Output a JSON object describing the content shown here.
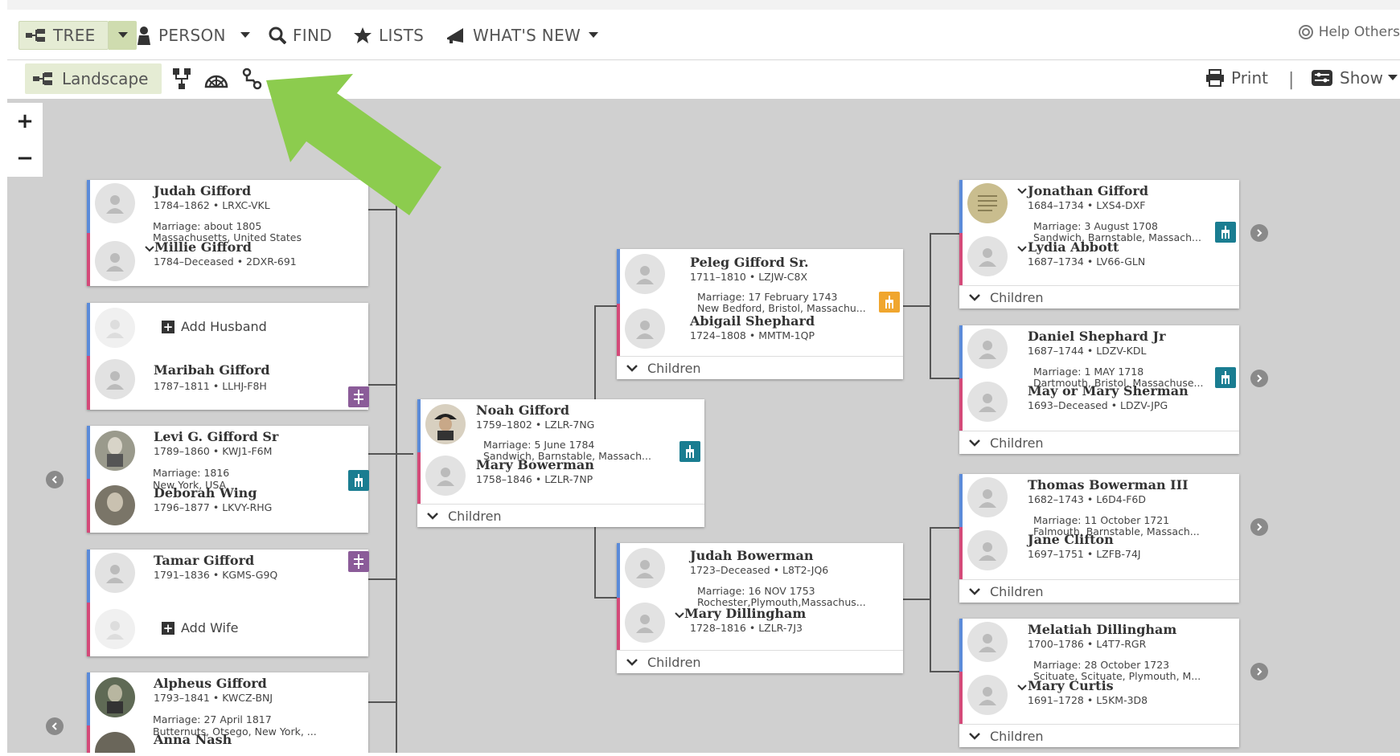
{
  "nav": {
    "tree": "TREE",
    "person": "PERSON",
    "find": "FIND",
    "lists": "LISTS",
    "whats_new": "WHAT'S NEW",
    "help": "Help Others"
  },
  "toolbar": {
    "landscape": "Landscape",
    "print": "Print",
    "separator": "|",
    "show": "Show"
  },
  "zoom": {
    "in": "+",
    "out": "−"
  },
  "children_label": "Children",
  "add_husband": "Add Husband",
  "add_wife": "Add Wife",
  "arrow_color": "#8ccc4e",
  "children_families": [
    {
      "husband": {
        "name": "Judah Gifford",
        "info": "1784–1862 • LRXC-VKL"
      },
      "marriage": [
        "Marriage: about 1805",
        "Massachusetts, United States"
      ],
      "wife": {
        "name": "Millie Gifford",
        "info": "1784–Deceased • 2DXR-691"
      }
    },
    {
      "wife": {
        "name": "Maribah Gifford",
        "info": "1787–1811 • LLHJ-F8H"
      }
    },
    {
      "husband": {
        "name": "Levi G. Gifford Sr",
        "info": "1789–1860 • KWJ1-F6M"
      },
      "marriage": [
        "Marriage: 1816",
        "New York, USA"
      ],
      "wife": {
        "name": "Deborah Wing",
        "info": "1796–1877 • LKVY-RHG"
      }
    },
    {
      "husband": {
        "name": "Tamar Gifford",
        "info": "1791–1836 • KGMS-G9Q"
      }
    },
    {
      "husband": {
        "name": "Alpheus Gifford",
        "info": "1793–1841 • KWCZ-BNJ"
      },
      "marriage": [
        "Marriage: 27 April 1817",
        "Butternuts, Otsego, New York, ..."
      ],
      "wife": {
        "name": "Anna Nash",
        "info": ""
      }
    }
  ],
  "focus": {
    "husband": {
      "name": "Noah Gifford",
      "info": "1759–1802 • LZLR-7NG"
    },
    "marriage": [
      "Marriage: 5 June 1784",
      "Sandwich, Barnstable, Massach..."
    ],
    "wife": {
      "name": "Mary Bowerman",
      "info": "1758–1846 • LZLR-7NP"
    }
  },
  "parents": [
    {
      "husband": {
        "name": "Peleg Gifford Sr.",
        "info": "1711–1810 • LZJW-C8X"
      },
      "marriage": [
        "Marriage: 17 February 1743",
        "New Bedford, Bristol, Massachu..."
      ],
      "wife": {
        "name": "Abigail Shephard",
        "info": "1724–1808 • MMTM-1QP"
      }
    },
    {
      "husband": {
        "name": "Judah Bowerman",
        "info": "1723–Deceased • L8T2-JQ6"
      },
      "marriage": [
        "Marriage: 16 NOV 1753",
        "Rochester,Plymouth,Massachus..."
      ],
      "wife": {
        "name": "Mary Dillingham",
        "info": "1728–1816 • LZLR-7J3"
      }
    }
  ],
  "grandparents": [
    {
      "husband": {
        "name": "Jonathan Gifford",
        "info": "1684–1734 • LXS4-DXF"
      },
      "marriage": [
        "Marriage: 3 August 1708",
        "Sandwich, Barnstable, Massach..."
      ],
      "wife": {
        "name": "Lydia Abbott",
        "info": "1687–1734 • LV66-GLN"
      }
    },
    {
      "husband": {
        "name": "Daniel Shephard Jr",
        "info": "1687–1744 • LDZV-KDL"
      },
      "marriage": [
        "Marriage: 1 MAY 1718",
        "Dartmouth, Bristol, Massachuse..."
      ],
      "wife": {
        "name": "May or Mary Sherman",
        "info": "1693–Deceased • LDZV-JPG"
      }
    },
    {
      "husband": {
        "name": "Thomas Bowerman III",
        "info": "1682–1743 • L6D4-F6D"
      },
      "marriage": [
        "Marriage: 11 October 1721",
        "Falmouth, Barnstable, Massach..."
      ],
      "wife": {
        "name": "Jane Clifton",
        "info": "1697–1751 • LZFB-74J"
      }
    },
    {
      "husband": {
        "name": "Melatiah Dillingham",
        "info": "1700–1786 • L4T7-RGR"
      },
      "marriage": [
        "Marriage: 28 October 1723",
        "Scituate, Scituate, Plymouth, M..."
      ],
      "wife": {
        "name": "Mary Curtis",
        "info": "1691–1728 • L5KM-3D8"
      }
    }
  ]
}
